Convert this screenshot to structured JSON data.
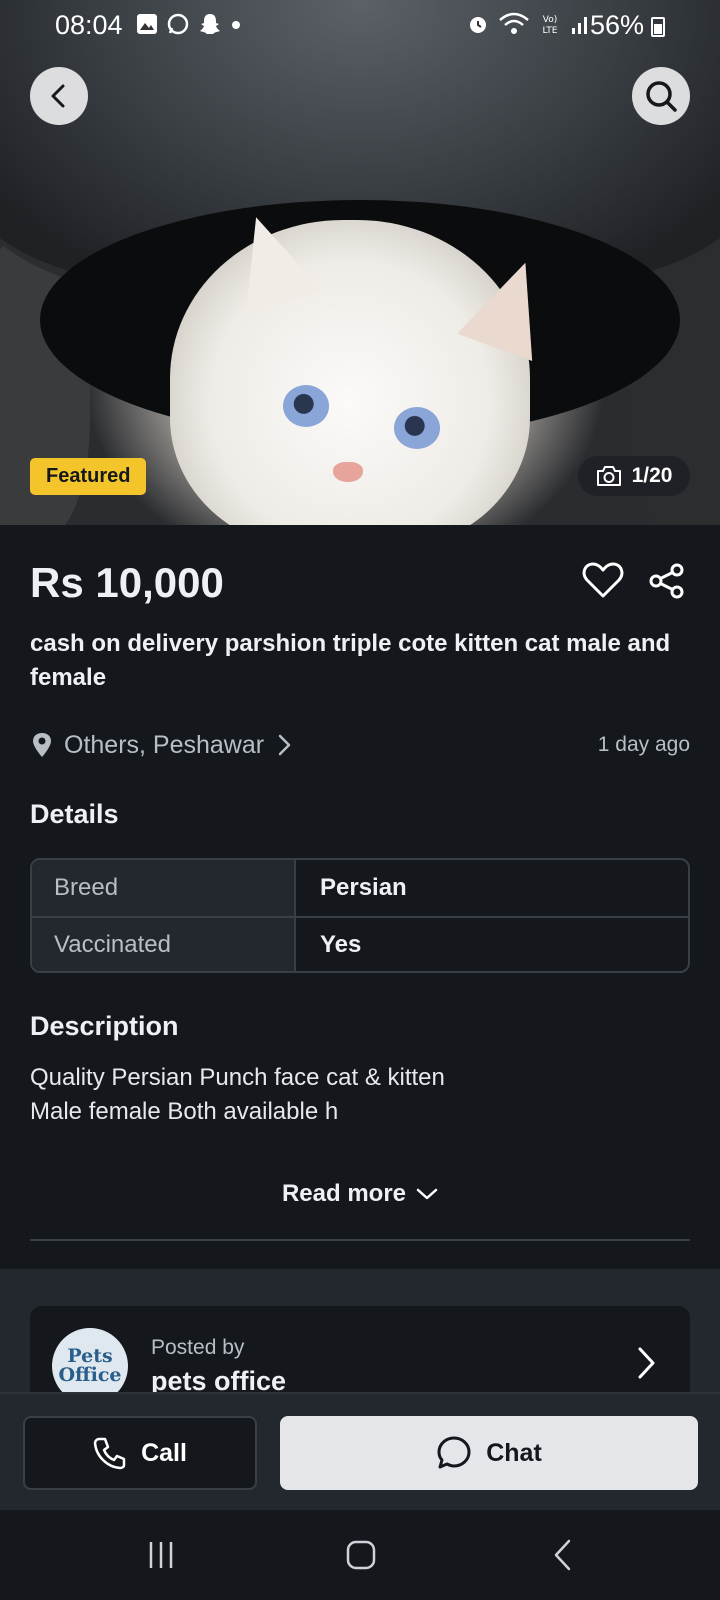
{
  "status_bar": {
    "time": "08:04",
    "battery": "56%"
  },
  "listing": {
    "featured_badge": "Featured",
    "photo_counter": "1/20",
    "price": "Rs 10,000",
    "title": "cash on delivery parshion triple cote kitten cat male and female",
    "location": "Others, Peshawar",
    "posted_time": "1 day ago"
  },
  "details": {
    "heading": "Details",
    "rows": [
      {
        "key": "Breed",
        "value": "Persian"
      },
      {
        "key": "Vaccinated",
        "value": "Yes"
      }
    ]
  },
  "description": {
    "heading": "Description",
    "text": "Quality Persian Punch face cat & kitten\nMale female Both available h",
    "read_more": "Read more"
  },
  "seller": {
    "posted_by_label": "Posted by",
    "name": "pets office",
    "avatar_text": "Pets Office"
  },
  "actions": {
    "call_label": "Call",
    "chat_label": "Chat"
  },
  "icons": {
    "back": "chevron-left-icon",
    "search": "search-icon",
    "camera": "camera-icon",
    "favorite": "heart-icon",
    "share": "share-icon",
    "location": "location-pin-icon",
    "phone": "phone-icon",
    "chat": "chat-bubble-icon"
  },
  "colors": {
    "background": "#14171c",
    "featured": "#f3c52b",
    "chat_button": "#e4e6ea"
  }
}
